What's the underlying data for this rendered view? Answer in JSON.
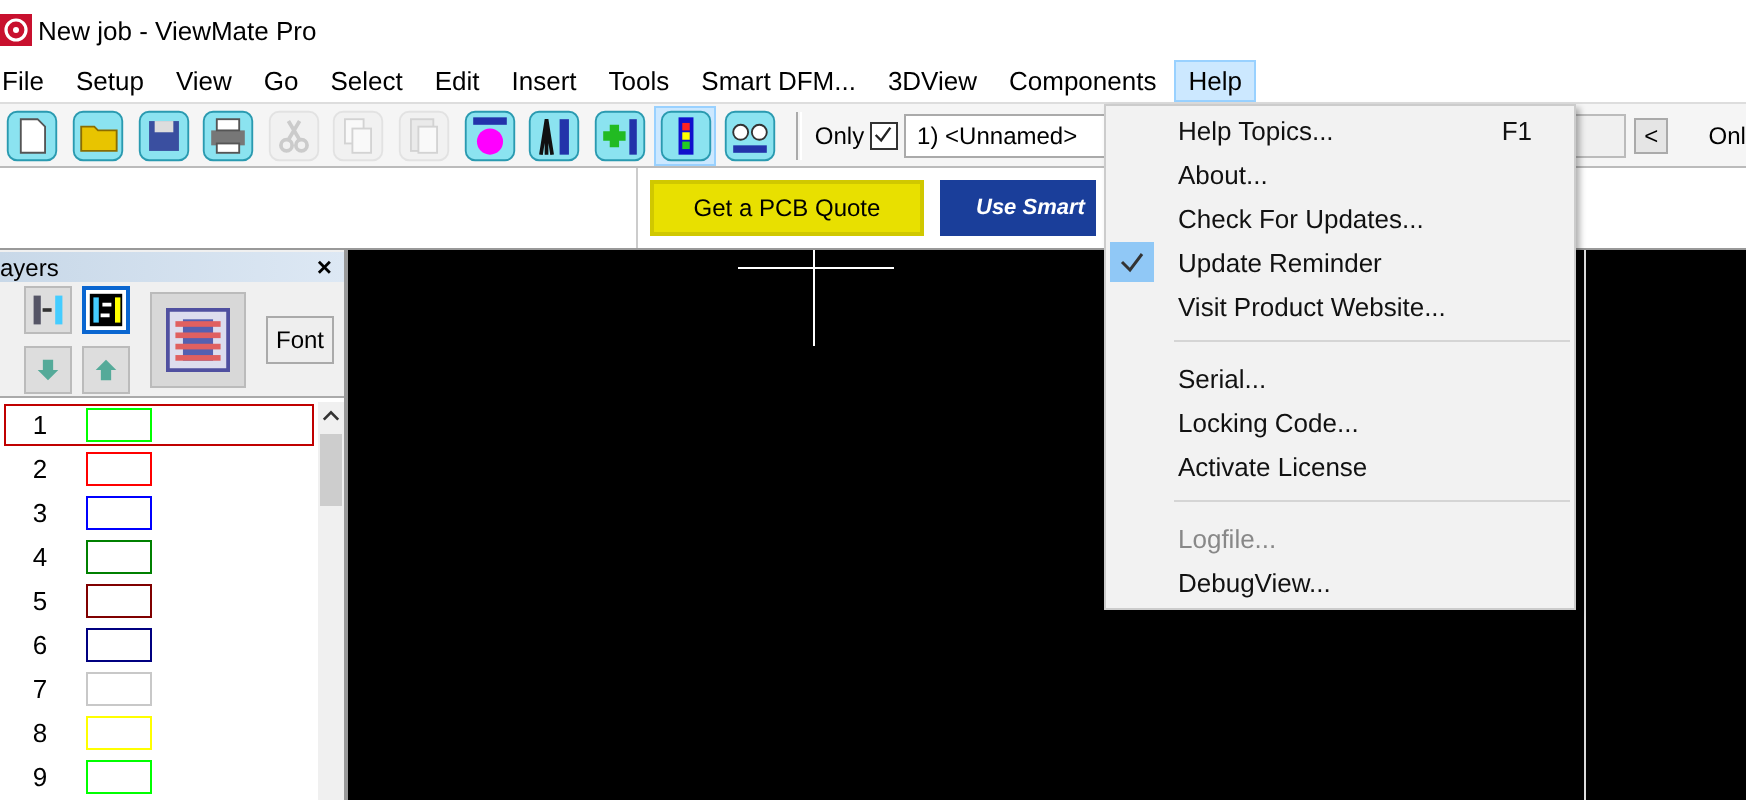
{
  "window": {
    "title": "New job - ViewMate Pro"
  },
  "menu_bar": [
    {
      "label": "File",
      "selected": false
    },
    {
      "label": "Setup",
      "selected": false
    },
    {
      "label": "View",
      "selected": false
    },
    {
      "label": "Go",
      "selected": false
    },
    {
      "label": "Select",
      "selected": false
    },
    {
      "label": "Edit",
      "selected": false
    },
    {
      "label": "Insert",
      "selected": false
    },
    {
      "label": "Tools",
      "selected": false
    },
    {
      "label": "Smart DFM...",
      "selected": false
    },
    {
      "label": "3DView",
      "selected": false
    },
    {
      "label": "Components",
      "selected": false
    },
    {
      "label": "Help",
      "selected": true
    }
  ],
  "toolbar": [
    {
      "kind": "new",
      "disabled": false,
      "selected": false
    },
    {
      "kind": "open",
      "disabled": false,
      "selected": false
    },
    {
      "kind": "save",
      "disabled": false,
      "selected": false
    },
    {
      "kind": "print",
      "disabled": false,
      "selected": false
    },
    {
      "kind": "cut",
      "disabled": true,
      "selected": false
    },
    {
      "kind": "copy",
      "disabled": true,
      "selected": false
    },
    {
      "kind": "paste",
      "disabled": true,
      "selected": false
    },
    {
      "kind": "pad",
      "disabled": false,
      "selected": false
    },
    {
      "kind": "calipers",
      "disabled": false,
      "selected": false
    },
    {
      "kind": "add",
      "disabled": false,
      "selected": false
    },
    {
      "kind": "colors",
      "disabled": false,
      "selected": true
    },
    {
      "kind": "glasses",
      "disabled": false,
      "selected": false
    }
  ],
  "layer_filter": {
    "label": "Only",
    "checked": true,
    "value": "1) <Unnamed>"
  },
  "toolbar_right": {
    "nav_button": "<",
    "label": "Onl"
  },
  "promo_buttons": [
    {
      "kind": "yellow",
      "label": "Get a PCB Quote"
    },
    {
      "kind": "blue",
      "label": "Use Smart"
    }
  ],
  "layers_panel": {
    "title": "ayers",
    "close": "×",
    "font_button": "Font",
    "layers": [
      {
        "number": "1",
        "color": "#00ff00",
        "selected": true
      },
      {
        "number": "2",
        "color": "#ff0000",
        "selected": false
      },
      {
        "number": "3",
        "color": "#0000ff",
        "selected": false
      },
      {
        "number": "4",
        "color": "#008000",
        "selected": false
      },
      {
        "number": "5",
        "color": "#800000",
        "selected": false
      },
      {
        "number": "6",
        "color": "#000080",
        "selected": false
      },
      {
        "number": "7",
        "color": "#c8c8c8",
        "selected": false
      },
      {
        "number": "8",
        "color": "#ffff00",
        "selected": false
      },
      {
        "number": "9",
        "color": "#00ff00",
        "selected": false
      }
    ]
  },
  "help_menu": [
    {
      "kind": "item",
      "label": "Help Topics...",
      "shortcut": "F1",
      "checked": false,
      "disabled": false
    },
    {
      "kind": "item",
      "label": "About...",
      "checked": false,
      "disabled": false
    },
    {
      "kind": "item",
      "label": "Check For Updates...",
      "checked": false,
      "disabled": false
    },
    {
      "kind": "item",
      "label": "Update Reminder",
      "checked": true,
      "disabled": false
    },
    {
      "kind": "item",
      "label": "Visit Product Website...",
      "checked": false,
      "disabled": false
    },
    {
      "kind": "separator"
    },
    {
      "kind": "item",
      "label": "Serial...",
      "checked": false,
      "disabled": false
    },
    {
      "kind": "item",
      "label": "Locking Code...",
      "checked": false,
      "disabled": false
    },
    {
      "kind": "item",
      "label": "Activate License",
      "checked": false,
      "disabled": false
    },
    {
      "kind": "separator"
    },
    {
      "kind": "item",
      "label": "Logfile...",
      "checked": false,
      "disabled": true
    },
    {
      "kind": "item",
      "label": "DebugView...",
      "checked": false,
      "disabled": false
    }
  ]
}
